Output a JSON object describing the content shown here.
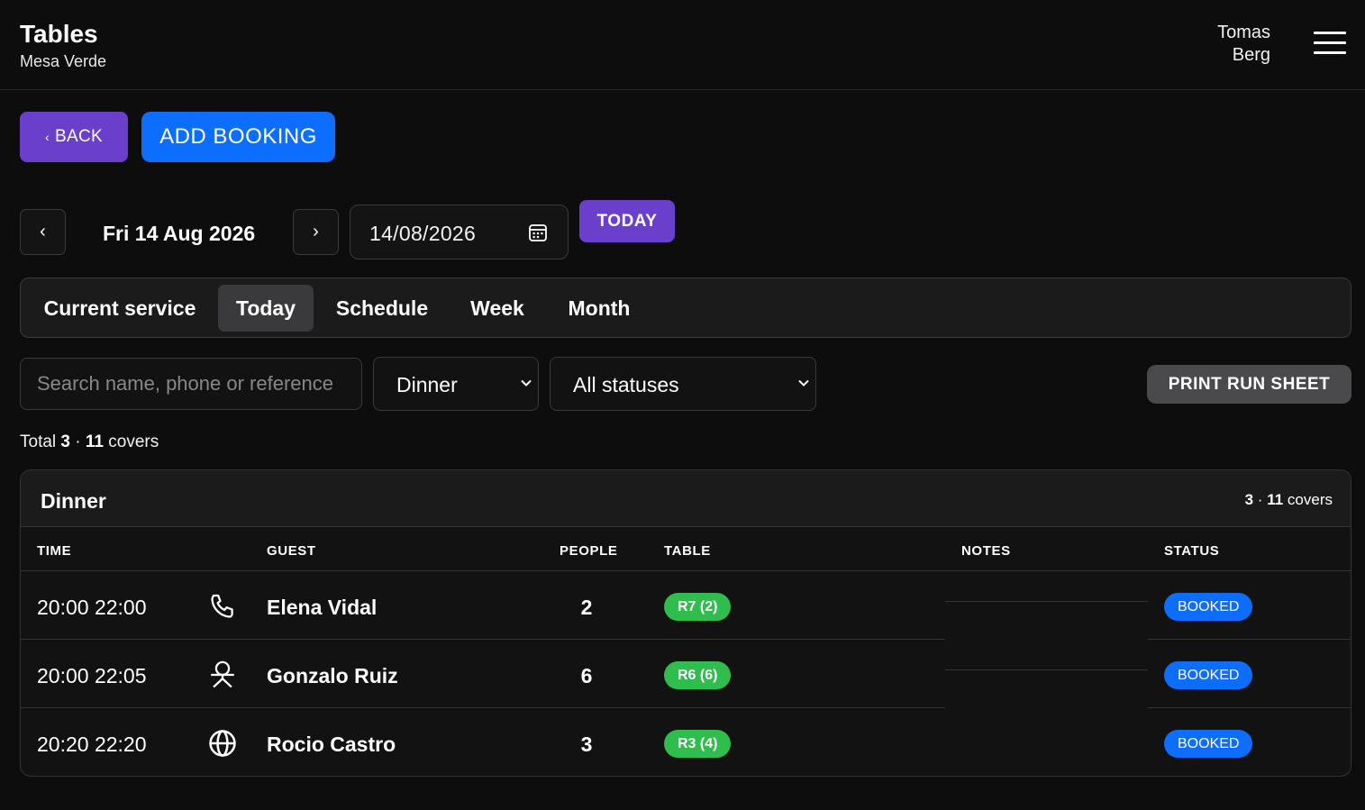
{
  "header": {
    "title": "Tables",
    "subtitle": "Mesa Verde",
    "user_line1": "Tomas",
    "user_line2": "Berg",
    "menu_icon": "hamburger-menu-icon"
  },
  "actions": {
    "back_chevron": "‹",
    "back_label": "BACK",
    "add_label": "ADD BOOKING",
    "back_color": "#6a3fcb",
    "add_color": "#0d6efd"
  },
  "date_nav": {
    "prev_label": "‹",
    "next_label": "›",
    "current_date": "Fri 14 Aug 2026",
    "date_input_value": "14/08/2026",
    "calendar_icon": "calendar-icon",
    "today_label": "TODAY"
  },
  "tabs": [
    {
      "label": "Current service",
      "active": false
    },
    {
      "label": "Today",
      "active": true
    },
    {
      "label": "Schedule",
      "active": false
    },
    {
      "label": "Week",
      "active": false
    },
    {
      "label": "Month",
      "active": false
    }
  ],
  "filters": {
    "search_placeholder": "Search name, phone or reference",
    "service_value": "Dinner",
    "status_value": "All statuses",
    "print_label": "PRINT RUN SHEET"
  },
  "totals": {
    "prefix": "Total",
    "bookings": "3",
    "separator": "·",
    "covers": "11",
    "suffix": "covers"
  },
  "service": {
    "title": "Dinner",
    "bookings": "3",
    "separator": "·",
    "covers": "11",
    "covers_label": "covers",
    "columns": {
      "time": "TIME",
      "guest": "GUEST",
      "people": "PEOPLE",
      "table": "TABLE",
      "notes": "NOTES",
      "status": "STATUS"
    },
    "rows": [
      {
        "time": "20:00 22:00",
        "source_icon": "phone-icon",
        "guest": "Elena Vidal",
        "people": "2",
        "table": "R7 (2)",
        "notes": "",
        "status": "BOOKED"
      },
      {
        "time": "20:00 22:05",
        "source_icon": "walk-in-person-icon",
        "guest": "Gonzalo Ruiz",
        "people": "6",
        "table": "R6 (6)",
        "notes": "",
        "status": "BOOKED"
      },
      {
        "time": "20:20 22:20",
        "source_icon": "globe-icon",
        "guest": "Rocio Castro",
        "people": "3",
        "table": "R3 (4)",
        "notes": "",
        "status": "BOOKED"
      }
    ]
  },
  "colors": {
    "background": "#0d0d0d",
    "table_pill": "#2fbd4e",
    "status_booked": "#0d6efd",
    "tab_active": "#3a3a3c"
  }
}
